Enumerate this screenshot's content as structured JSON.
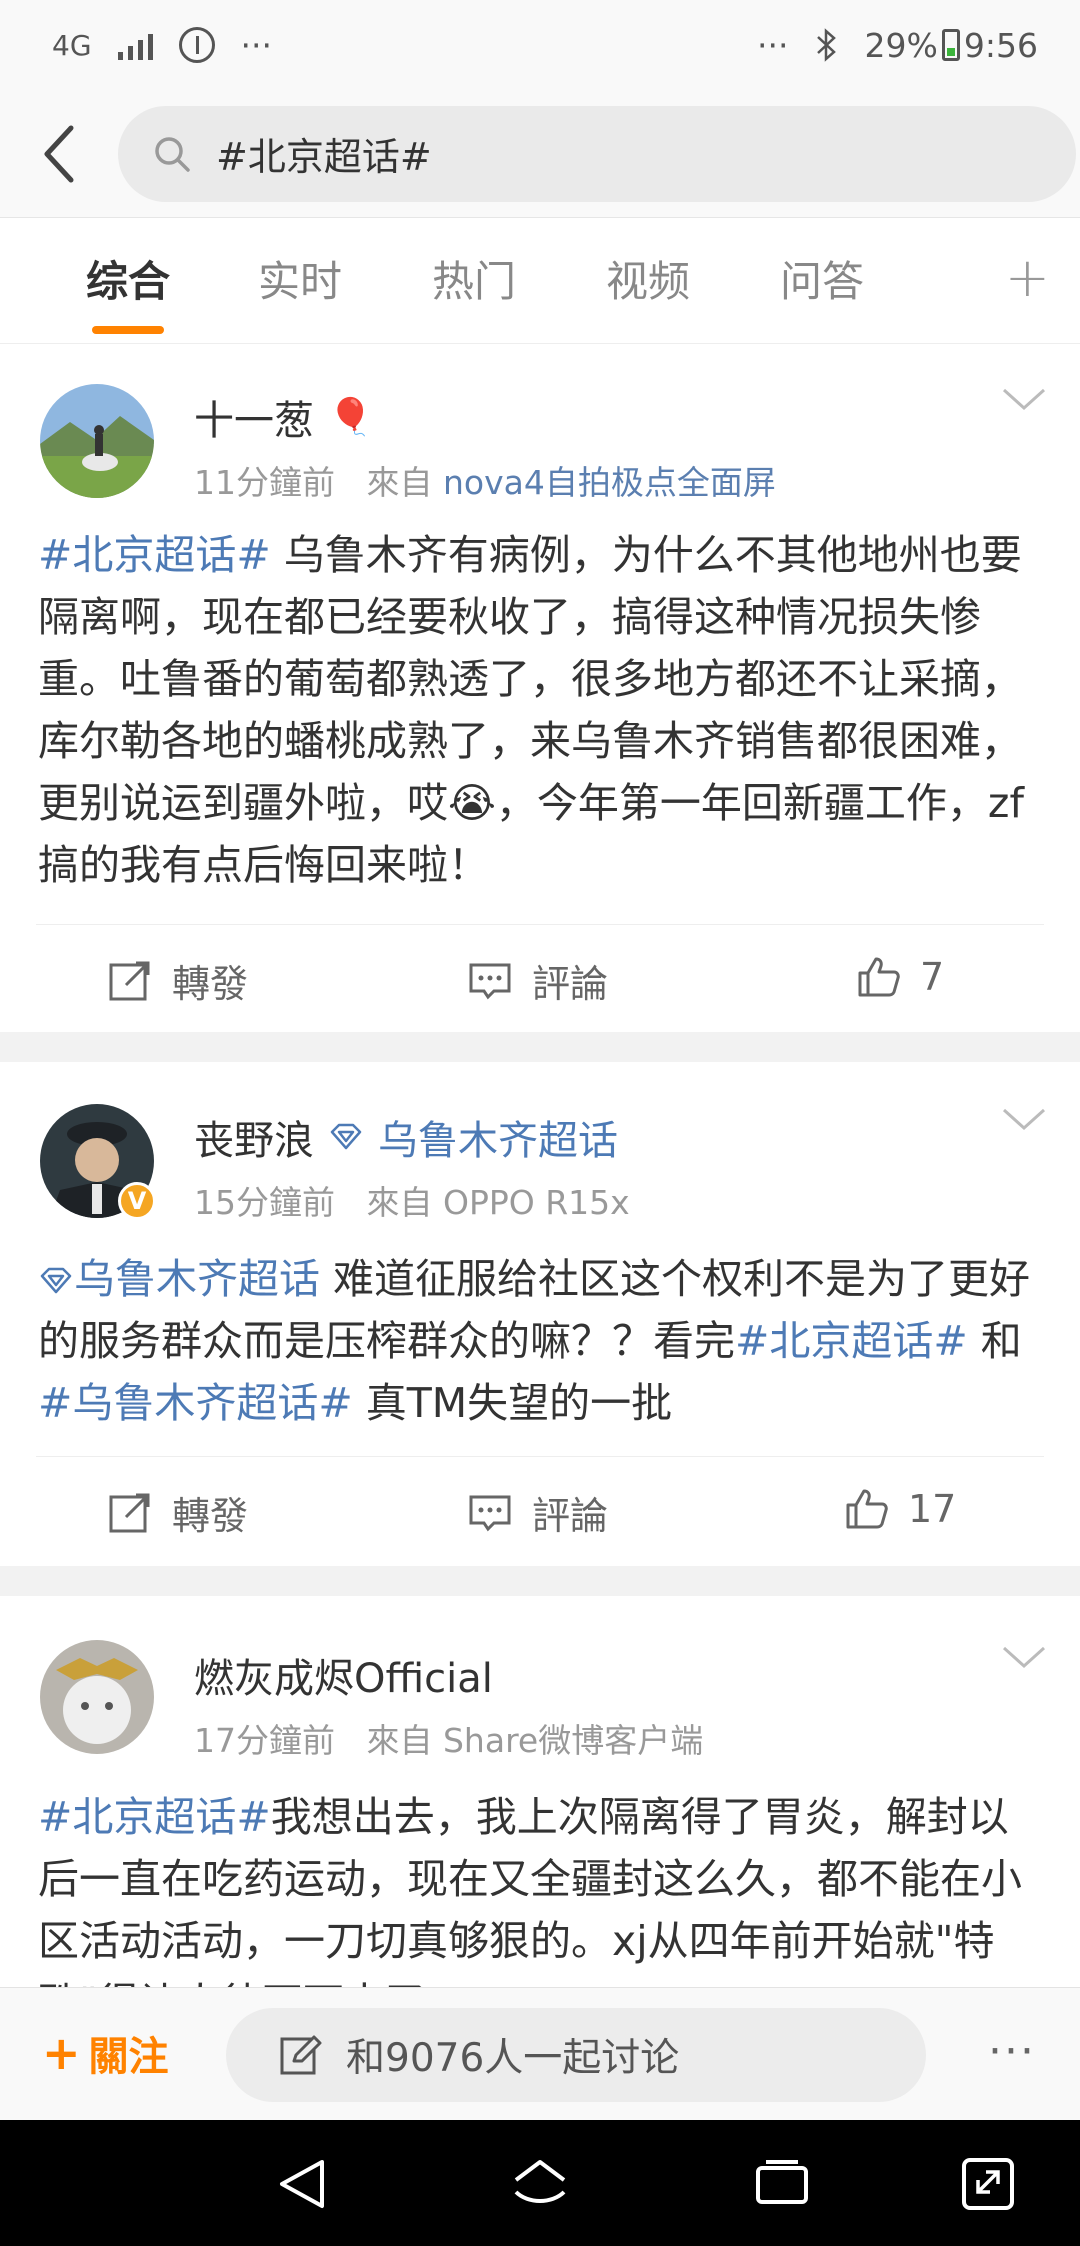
{
  "status_bar": {
    "network": "4G",
    "dots_left": "···",
    "dots_right": "···",
    "battery": "29%",
    "time": "9:56"
  },
  "search": {
    "query": "#北京超话#"
  },
  "tabs": [
    "综合",
    "实时",
    "热门",
    "视频",
    "问答"
  ],
  "posts": [
    {
      "user": "十一葱",
      "badge": "🎈",
      "time": "11分鐘前",
      "from_label": "來自",
      "source": "nova4自拍极点全面屏",
      "tag": "#北京超话#",
      "text": " 乌鲁木齐有病例，为什么不其他地州也要隔离啊，现在都已经要秋收了，搞得这种情况损失惨重。吐鲁番的葡萄都熟透了，很多地方都还不让采摘，库尔勒各地的蟠桃成熟了，来乌鲁木齐销售都很困难，更别说运到疆外啦，哎",
      "emoji": "😭",
      "text_after": "，今年第一年回新疆工作，zf搞的我有点后悔回来啦！",
      "repost": "轉發",
      "comment": "評論",
      "likes": "7"
    },
    {
      "user": "丧野浪",
      "supertopic": "乌鲁木齐超话",
      "time": "15分鐘前",
      "from_label": "來自",
      "source": "OPPO R15x",
      "tag_lead": "乌鲁木齐超话",
      "text1": " 难道征服给社区这个权利不是为了更好的服务群众而是压榨群众的嘛？？看完",
      "tag2": "#北京超话#",
      "text2": " 和",
      "tag3": "#乌鲁木齐超话#",
      "text3": " 真TM失望的一批",
      "repost": "轉發",
      "comment": "評論",
      "likes": "17"
    },
    {
      "user": "燃灰成烬Official",
      "time": "17分鐘前",
      "from_label": "來自",
      "source": "Share微博客户端",
      "tag": "#北京超话#",
      "text": "我想出去，我上次隔离得了胃炎，解封以后一直在吃药运动，现在又全疆封这么久，都不能在小区活动活动，一刀切真够狠的。xj从四年前开始就\"特殊\"得让人待不下去了"
    }
  ],
  "bottom_bar": {
    "follow": "關注",
    "discuss": "和9076人一起讨论"
  }
}
